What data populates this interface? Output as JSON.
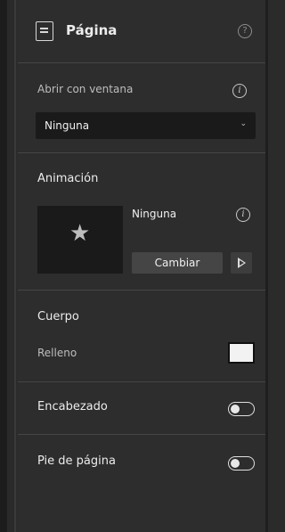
{
  "header": {
    "title": "Página",
    "help_icon": "?"
  },
  "open_with_window": {
    "label": "Abrir con ventana",
    "selected": "Ninguna",
    "info_icon": "i"
  },
  "animation": {
    "title": "Animación",
    "value": "Ninguna",
    "change_label": "Cambiar",
    "info_icon": "i"
  },
  "body_section": {
    "title": "Cuerpo",
    "fill_label": "Relleno",
    "fill_color": "#f2f2f2"
  },
  "header_toggle": {
    "label": "Encabezado",
    "enabled": false
  },
  "footer_toggle": {
    "label": "Pie de página",
    "enabled": false
  }
}
